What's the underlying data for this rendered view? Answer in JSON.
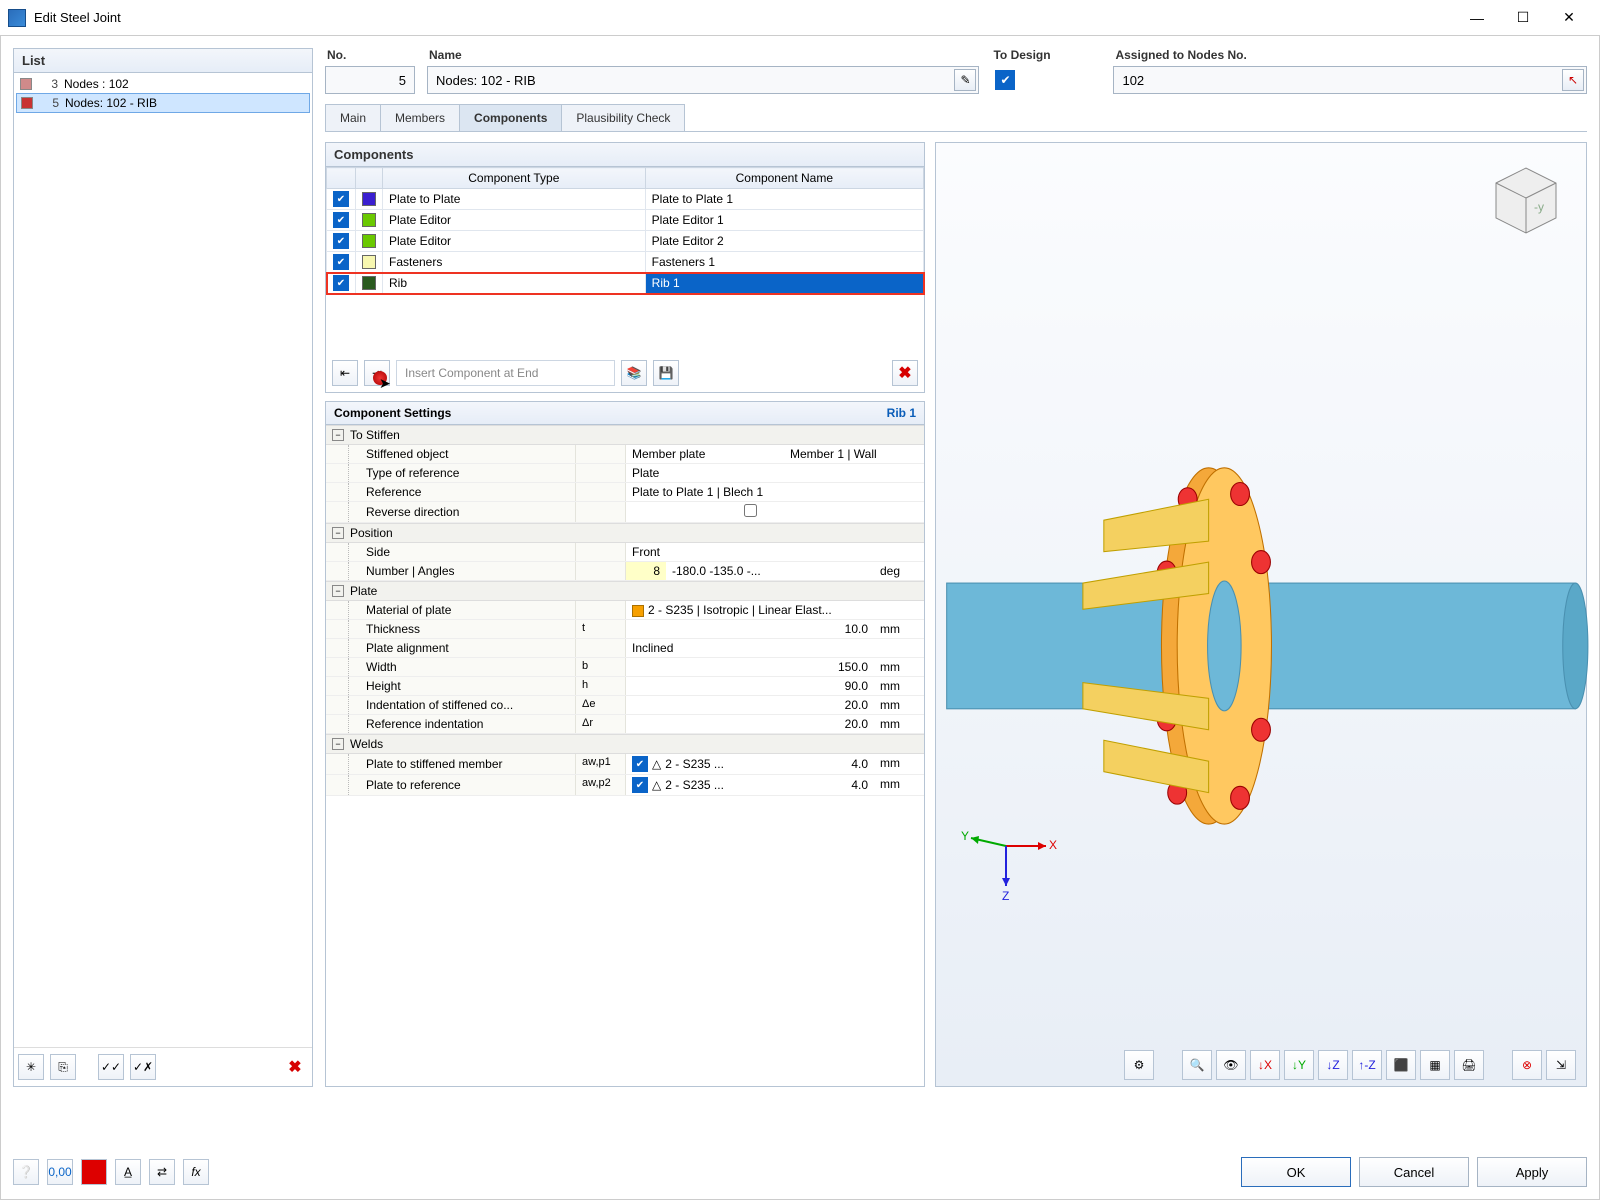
{
  "window": {
    "title": "Edit Steel Joint"
  },
  "left": {
    "header": "List",
    "items": [
      {
        "num": "3",
        "color": "#d08a8a",
        "label": "Nodes : 102"
      },
      {
        "num": "5",
        "color": "#c83232",
        "label": "Nodes: 102 - RIB"
      }
    ]
  },
  "header": {
    "no_label": "No.",
    "no_value": "5",
    "name_label": "Name",
    "name_value": "Nodes: 102 - RIB",
    "design_label": "To Design",
    "nodes_label": "Assigned to Nodes No.",
    "nodes_value": "102"
  },
  "tabs": [
    "Main",
    "Members",
    "Components",
    "Plausibility Check"
  ],
  "active_tab": "Components",
  "components": {
    "title": "Components",
    "col_type": "Component Type",
    "col_name": "Component Name",
    "rows": [
      {
        "color": "#3a1fd0",
        "type": "Plate to Plate",
        "name": "Plate to Plate 1"
      },
      {
        "color": "#6ac800",
        "type": "Plate Editor",
        "name": "Plate Editor 1"
      },
      {
        "color": "#6ac800",
        "type": "Plate Editor",
        "name": "Plate Editor 2"
      },
      {
        "color": "#f7f7b0",
        "type": "Fasteners",
        "name": "Fasteners 1"
      },
      {
        "color": "#2a5a1f",
        "type": "Rib",
        "name": "Rib 1"
      }
    ],
    "insert_placeholder": "Insert Component at End"
  },
  "settings": {
    "title": "Component Settings",
    "selected": "Rib 1",
    "groups": {
      "stiffen": {
        "title": "To Stiffen",
        "stiffened_object_lbl": "Stiffened object",
        "stiffened_object_val": "Member plate",
        "stiffened_object_extra": "Member 1 | Wall",
        "type_ref_lbl": "Type of reference",
        "type_ref_val": "Plate",
        "reference_lbl": "Reference",
        "reference_val": "Plate to Plate 1 | Blech 1",
        "reverse_lbl": "Reverse direction"
      },
      "position": {
        "title": "Position",
        "side_lbl": "Side",
        "side_val": "Front",
        "num_lbl": "Number | Angles",
        "num_val": "8",
        "angles_val": "-180.0 -135.0 -...",
        "unit": "deg"
      },
      "plate": {
        "title": "Plate",
        "material_lbl": "Material of plate",
        "material_val": "2 - S235 | Isotropic | Linear Elast...",
        "thickness_lbl": "Thickness",
        "thickness_sym": "t",
        "thickness_val": "10.0",
        "align_lbl": "Plate alignment",
        "align_val": "Inclined",
        "width_lbl": "Width",
        "width_sym": "b",
        "width_val": "150.0",
        "height_lbl": "Height",
        "height_sym": "h",
        "height_val": "90.0",
        "indent_lbl": "Indentation of stiffened co...",
        "indent_sym": "Δe",
        "indent_val": "20.0",
        "refind_lbl": "Reference indentation",
        "refind_sym": "Δr",
        "refind_val": "20.0",
        "unit": "mm"
      },
      "welds": {
        "title": "Welds",
        "w1_lbl": "Plate to stiffened member",
        "w1_sym": "aw,p1",
        "w1_mat": "2 - S235 ...",
        "w1_val": "4.0",
        "w2_lbl": "Plate to reference",
        "w2_sym": "aw,p2",
        "w2_mat": "2 - S235 ...",
        "w2_val": "4.0",
        "unit": "mm"
      }
    }
  },
  "buttons": {
    "ok": "OK",
    "cancel": "Cancel",
    "apply": "Apply"
  },
  "colors": {
    "accent": "#0a64c8"
  }
}
